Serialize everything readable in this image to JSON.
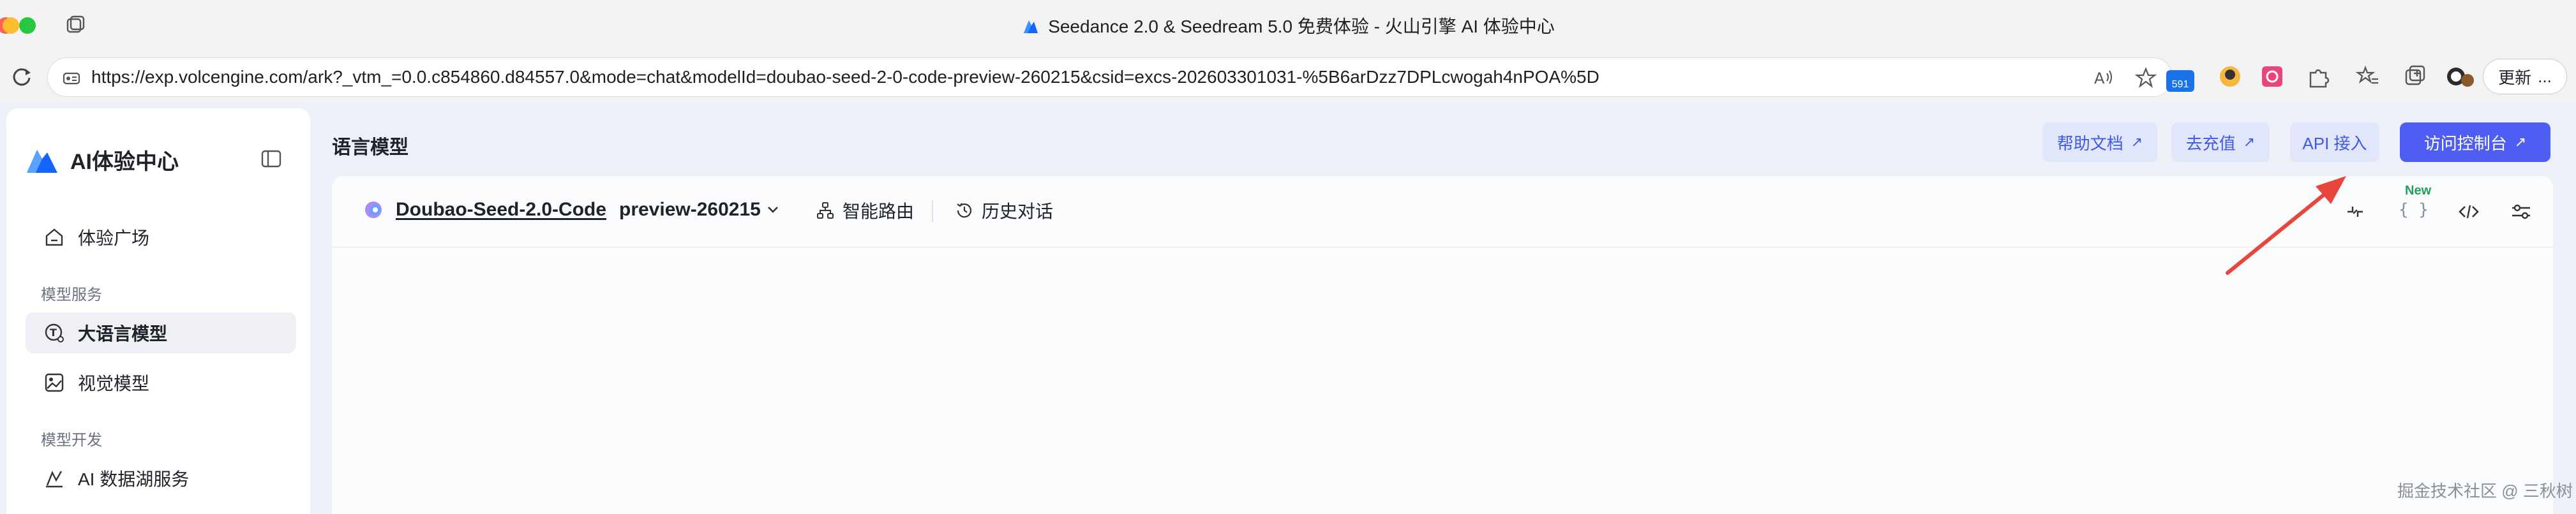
{
  "window": {
    "title": "Seedance 2.0 & Seedream 5.0 免费体验 - 火山引擎 AI 体验中心"
  },
  "address_bar": {
    "url": "https://exp.volcengine.com/ark?_vtm_=0.0.c854860.d84557.0&mode=chat&modelId=doubao-seed-2-0-code-preview-260215&csid=excs-202603301031-%5B6arDzz7DPLcwogah4nPOA%5D",
    "extension_badge_count": "591",
    "update_label": "更新",
    "more_label": "..."
  },
  "sidebar": {
    "brand": "AI体验中心",
    "items": [
      {
        "label": "体验广场",
        "icon": "home-icon"
      },
      {
        "label": "大语言模型",
        "icon": "chat-model-icon",
        "active": true
      },
      {
        "label": "视觉模型",
        "icon": "image-icon"
      },
      {
        "label": "AI 数据湖服务",
        "icon": "data-lake-icon"
      }
    ],
    "sections": [
      "模型服务",
      "模型开发"
    ]
  },
  "header": {
    "title": "语言模型",
    "buttons": [
      {
        "label": "帮助文档"
      },
      {
        "label": "去充值"
      },
      {
        "label": "API 接入"
      },
      {
        "label": "访问控制台"
      }
    ],
    "arrow_glyph": "↗"
  },
  "model_bar": {
    "model_name": "Doubao-Seed-2.0-Code",
    "model_version": "preview-260215",
    "route_label": "智能路由",
    "history_label": "历史对话",
    "new_tag": "New",
    "braces_label": "{ }"
  },
  "watermark": "掘金技术社区 @ 三秋树",
  "colors": {
    "accent": "#4e5ef5",
    "secondary_btn_bg": "#e2e6fb",
    "annotation_arrow": "#e8453c",
    "new_tag": "#1fa05a"
  }
}
